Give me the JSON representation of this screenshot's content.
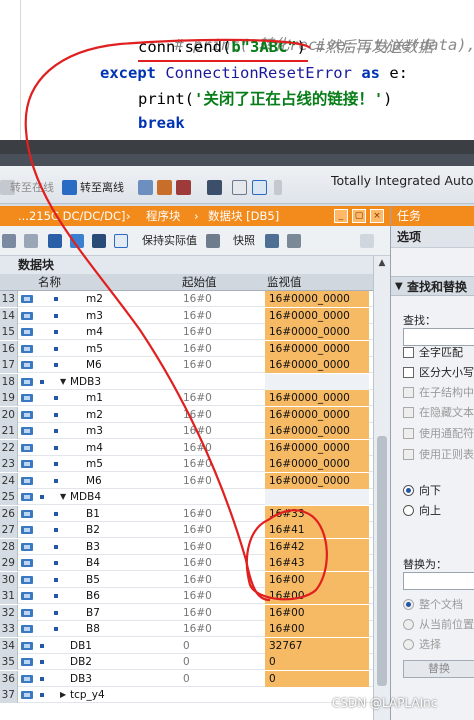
{
  "code": {
    "line1_prefix": "# print('转化recive:',type(data),typ",
    "line2_call": "conn.send(",
    "line2_bytes": "b\"3ABC\"",
    "line2_close": ")",
    "line2_comment": " #然后再发送数据",
    "line3_kw1": "except",
    "line3_err": " ConnectionResetError ",
    "line3_kw2": "as",
    "line3_var": " e:",
    "line4_fn": "print(",
    "line4_str": "'关闭了正在占线的链接！'",
    "line4_close": ")",
    "line5_kw": "break"
  },
  "toolbar": {
    "go_offline": "转至在线",
    "go_offline2": "转至离线",
    "app_title": "Totally Integrated Autom"
  },
  "breadcrumb": {
    "device": "...215C DC/DC/DC]",
    "sep1": "›",
    "blocks": "程序块",
    "sep2": "›",
    "db": "数据块 [DB5]"
  },
  "block_toolbar": {
    "keep_actual": "保持实际值",
    "snapshot": "快照"
  },
  "db": {
    "title": "数据块",
    "headers": {
      "name": "名称",
      "start": "起始值",
      "monitor": "监视值"
    },
    "rows": [
      {
        "num": "13",
        "name": "m2",
        "indent": 2,
        "start": "16#0",
        "monitor": "16#0000_0000"
      },
      {
        "num": "14",
        "name": "m3",
        "indent": 2,
        "start": "16#0",
        "monitor": "16#0000_0000"
      },
      {
        "num": "15",
        "name": "m4",
        "indent": 2,
        "start": "16#0",
        "monitor": "16#0000_0000"
      },
      {
        "num": "16",
        "name": "m5",
        "indent": 2,
        "start": "16#0",
        "monitor": "16#0000_0000"
      },
      {
        "num": "17",
        "name": "M6",
        "indent": 2,
        "start": "16#0",
        "monitor": "16#0000_0000"
      },
      {
        "num": "18",
        "name": "MDB3",
        "indent": 1,
        "start": "",
        "monitor": "",
        "group": true
      },
      {
        "num": "19",
        "name": "m1",
        "indent": 2,
        "start": "16#0",
        "monitor": "16#0000_0000"
      },
      {
        "num": "20",
        "name": "m2",
        "indent": 2,
        "start": "16#0",
        "monitor": "16#0000_0000"
      },
      {
        "num": "21",
        "name": "m3",
        "indent": 2,
        "start": "16#0",
        "monitor": "16#0000_0000"
      },
      {
        "num": "22",
        "name": "m4",
        "indent": 2,
        "start": "16#0",
        "monitor": "16#0000_0000"
      },
      {
        "num": "23",
        "name": "m5",
        "indent": 2,
        "start": "16#0",
        "monitor": "16#0000_0000"
      },
      {
        "num": "24",
        "name": "M6",
        "indent": 2,
        "start": "16#0",
        "monitor": "16#0000_0000"
      },
      {
        "num": "25",
        "name": "MDB4",
        "indent": 1,
        "start": "",
        "monitor": "",
        "group": true
      },
      {
        "num": "26",
        "name": "B1",
        "indent": 2,
        "start": "16#0",
        "monitor": "16#33"
      },
      {
        "num": "27",
        "name": "B2",
        "indent": 2,
        "start": "16#0",
        "monitor": "16#41"
      },
      {
        "num": "28",
        "name": "B3",
        "indent": 2,
        "start": "16#0",
        "monitor": "16#42"
      },
      {
        "num": "29",
        "name": "B4",
        "indent": 2,
        "start": "16#0",
        "monitor": "16#43"
      },
      {
        "num": "30",
        "name": "B5",
        "indent": 2,
        "start": "16#0",
        "monitor": "16#00"
      },
      {
        "num": "31",
        "name": "B6",
        "indent": 2,
        "start": "16#0",
        "monitor": "16#00"
      },
      {
        "num": "32",
        "name": "B7",
        "indent": 2,
        "start": "16#0",
        "monitor": "16#00"
      },
      {
        "num": "33",
        "name": "B8",
        "indent": 2,
        "start": "16#0",
        "monitor": "16#00"
      },
      {
        "num": "34",
        "name": "DB1",
        "indent": 1,
        "start": "0",
        "monitor": "32767"
      },
      {
        "num": "35",
        "name": "DB2",
        "indent": 1,
        "start": "0",
        "monitor": "0"
      },
      {
        "num": "36",
        "name": "DB3",
        "indent": 1,
        "start": "0",
        "monitor": "0"
      },
      {
        "num": "37",
        "name": "tcp_y4",
        "indent": 1,
        "start": "",
        "monitor": "",
        "group": true
      }
    ]
  },
  "task_panel": {
    "title": "任务",
    "options": "选项",
    "find_replace": "查找和替换",
    "find_label": "查找：",
    "checks": [
      {
        "label": "全字匹配",
        "enabled": true
      },
      {
        "label": "区分大小写",
        "enabled": true
      },
      {
        "label": "在子结构中查",
        "enabled": false
      },
      {
        "label": "在隐藏文本中",
        "enabled": false
      },
      {
        "label": "使用通配符",
        "enabled": false
      },
      {
        "label": "使用正则表达",
        "enabled": false
      }
    ],
    "dir_down": "向下",
    "dir_up": "向上",
    "replace_label": "替换为：",
    "scope": [
      {
        "label": "整个文档"
      },
      {
        "label": "从当前位置开"
      },
      {
        "label": "选择"
      }
    ],
    "replace_button": "替换"
  },
  "watermark": "CSDN @LAPLAInc",
  "colors": {
    "accent_orange": "#f28a1c",
    "monitor_fill": "#f6ba65",
    "annotation_red": "#e02020"
  }
}
